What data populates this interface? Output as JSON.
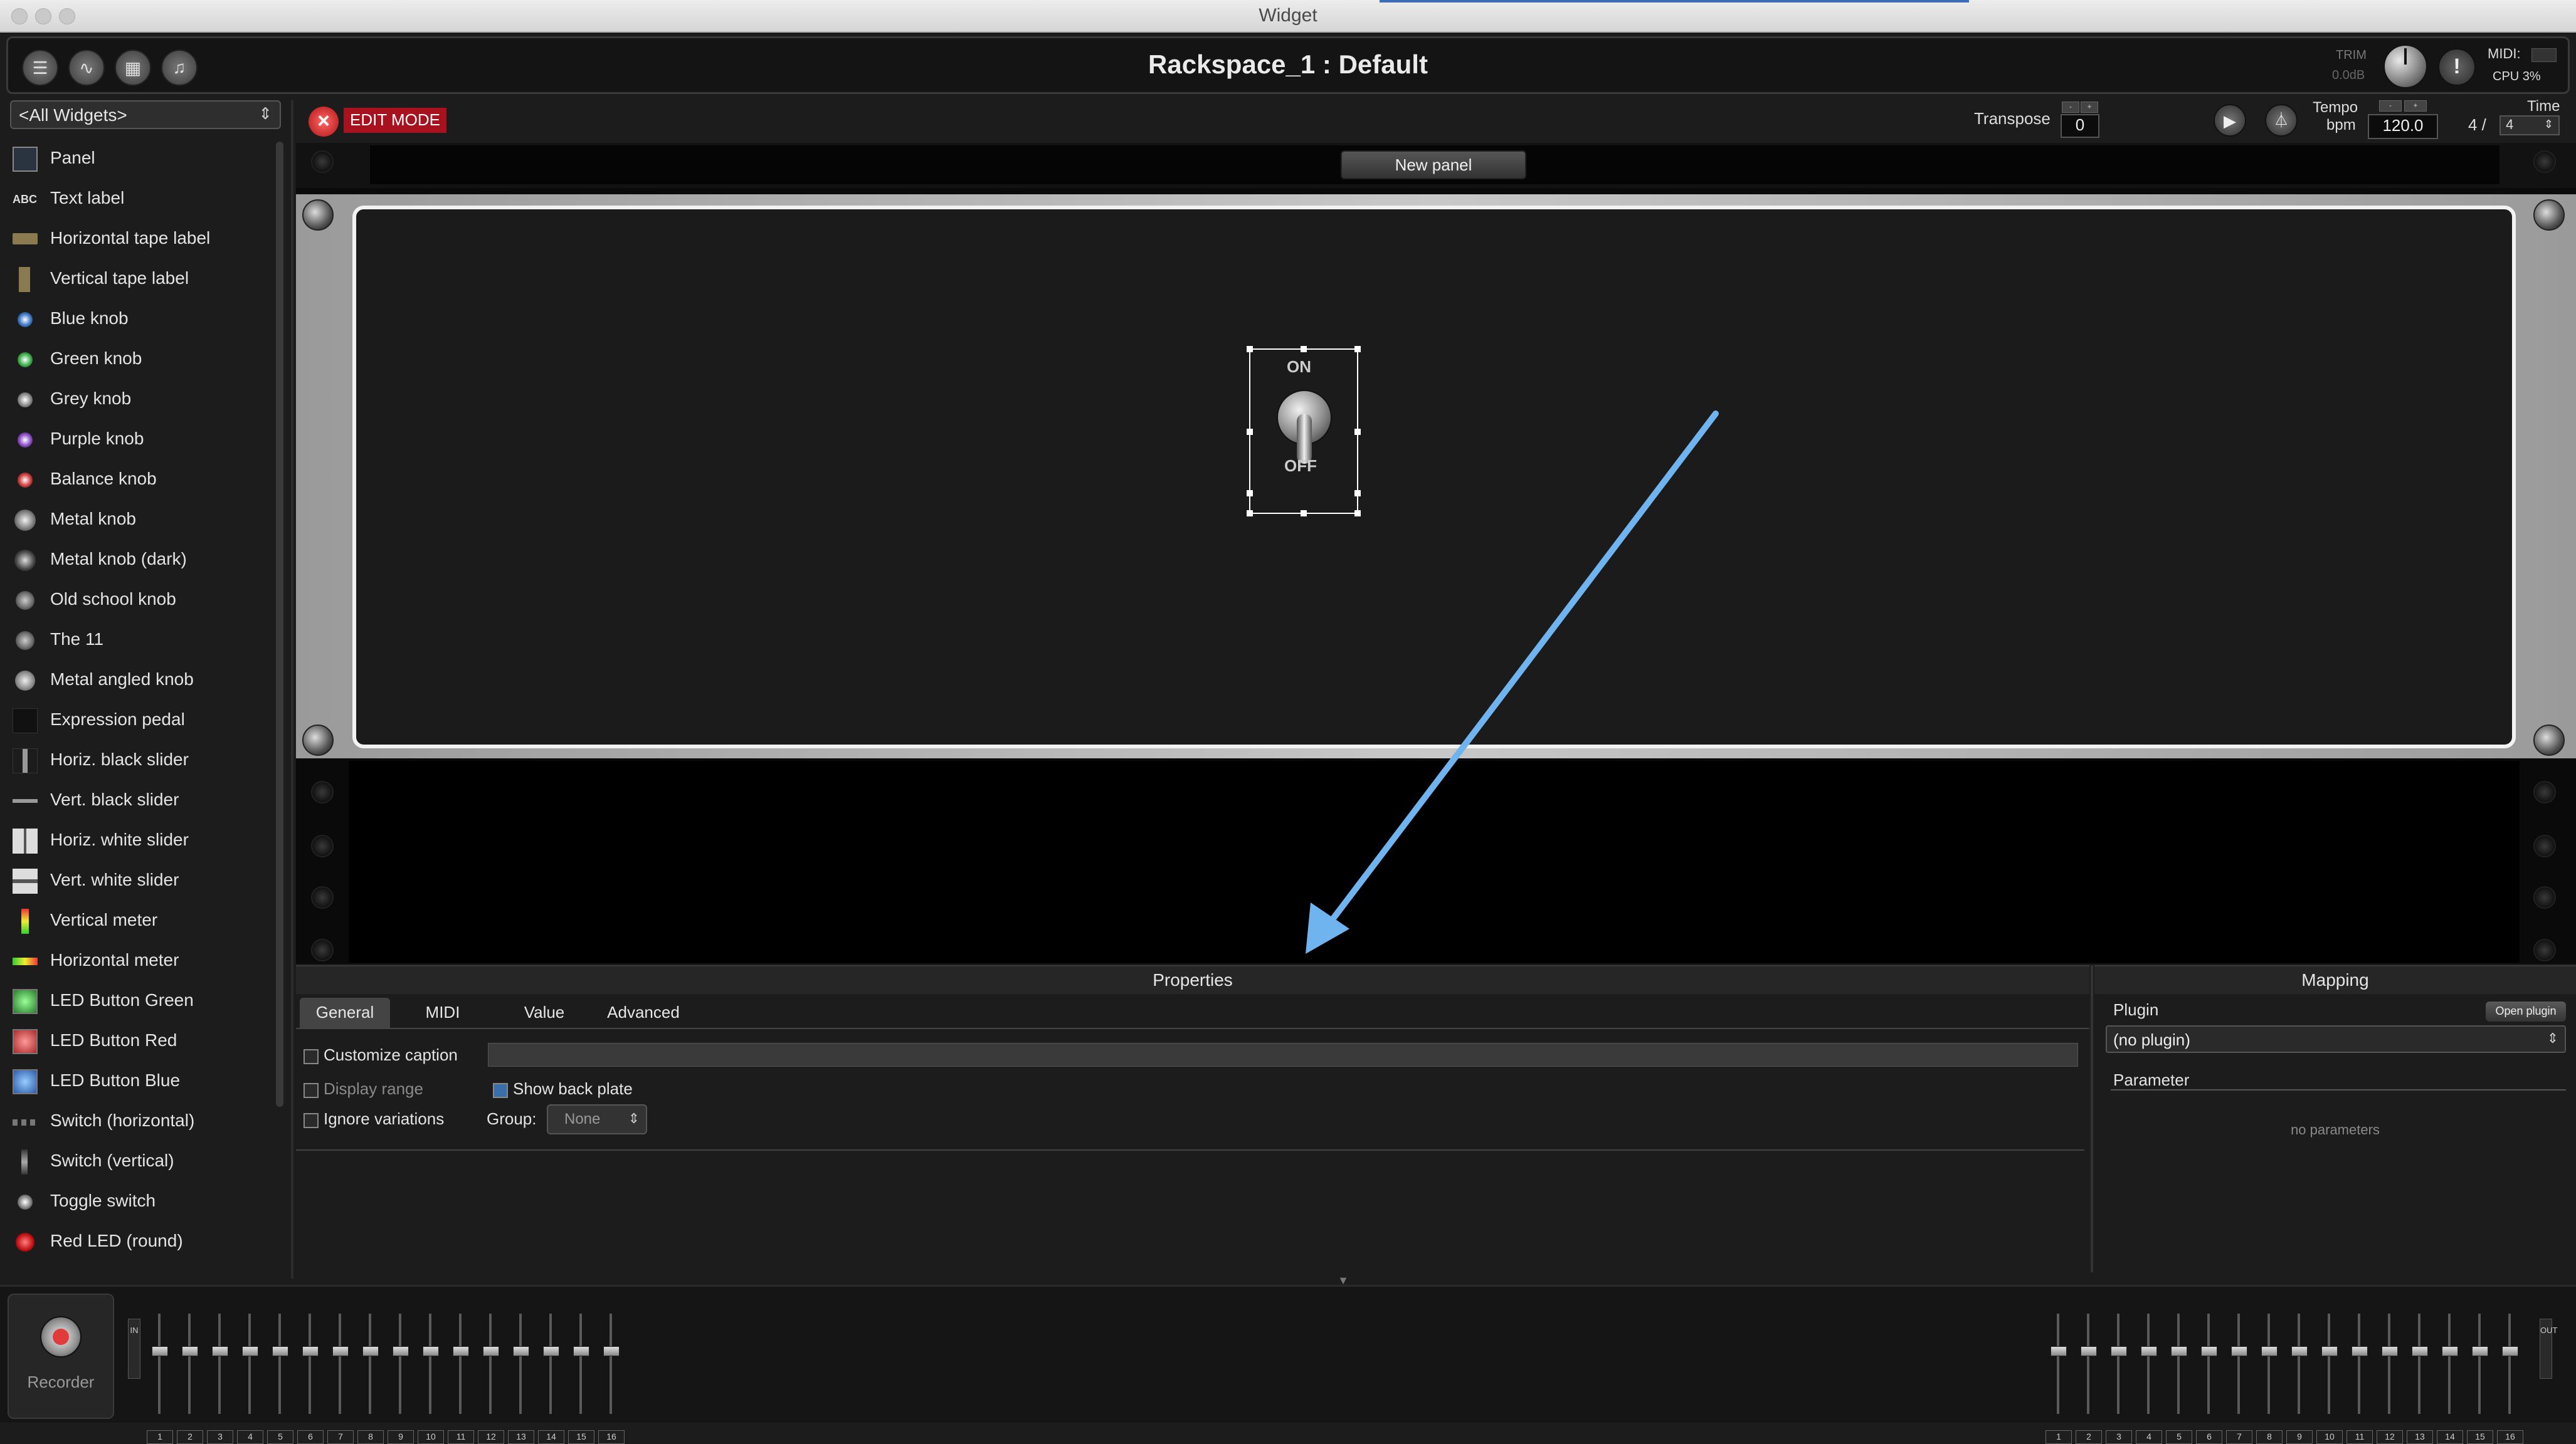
{
  "window": {
    "title": "Widget"
  },
  "header": {
    "rackspace_title": "Rackspace_1 : Default",
    "trim_label": "TRIM",
    "trim_value": "0.0dB",
    "panic_symbol": "!",
    "midi_label": "MIDI:",
    "cpu_label": "CPU 3%"
  },
  "sidebar": {
    "filter": "<All Widgets>",
    "items": [
      {
        "label": "Panel",
        "icon": "panel-icon"
      },
      {
        "label": "Text label",
        "icon": "abc-text-icon"
      },
      {
        "label": "Horizontal tape label",
        "icon": "tape-label-icon"
      },
      {
        "label": "Vertical tape label",
        "icon": "vertical-tape-icon"
      },
      {
        "label": "Blue knob",
        "icon": "blue-knob-icon"
      },
      {
        "label": "Green knob",
        "icon": "green-knob-icon"
      },
      {
        "label": "Grey knob",
        "icon": "grey-knob-icon"
      },
      {
        "label": "Purple knob",
        "icon": "purple-knob-icon"
      },
      {
        "label": "Balance knob",
        "icon": "balance-knob-icon"
      },
      {
        "label": "Metal knob",
        "icon": "metal-knob-icon"
      },
      {
        "label": "Metal knob (dark)",
        "icon": "metal-knob-dark-icon"
      },
      {
        "label": "Old school knob",
        "icon": "old-school-knob-icon"
      },
      {
        "label": "The 11",
        "icon": "the-11-knob-icon"
      },
      {
        "label": "Metal angled knob",
        "icon": "metal-angled-knob-icon"
      },
      {
        "label": "Expression pedal",
        "icon": "expression-pedal-icon"
      },
      {
        "label": "Horiz. black slider",
        "icon": "horiz-black-slider-icon"
      },
      {
        "label": "Vert. black slider",
        "icon": "vert-black-slider-icon"
      },
      {
        "label": "Horiz. white slider",
        "icon": "horiz-white-slider-icon"
      },
      {
        "label": "Vert. white slider",
        "icon": "vert-white-slider-icon"
      },
      {
        "label": "Vertical meter",
        "icon": "vertical-meter-icon"
      },
      {
        "label": "Horizontal meter",
        "icon": "horizontal-meter-icon"
      },
      {
        "label": "LED Button Green",
        "icon": "led-button-green-icon"
      },
      {
        "label": "LED Button Red",
        "icon": "led-button-red-icon"
      },
      {
        "label": "LED Button Blue",
        "icon": "led-button-blue-icon"
      },
      {
        "label": "Switch (horizontal)",
        "icon": "switch-horizontal-icon"
      },
      {
        "label": "Switch (vertical)",
        "icon": "switch-vertical-icon"
      },
      {
        "label": "Toggle switch",
        "icon": "toggle-switch-icon"
      },
      {
        "label": "Red LED (round)",
        "icon": "red-led-icon"
      }
    ]
  },
  "toolbar": {
    "edit_mode": "EDIT MODE",
    "transpose_label": "Transpose",
    "transpose_value": "0",
    "tempo_label": "Tempo",
    "bpm_label": "bpm",
    "tempo_value": "120.0",
    "time_label": "Time",
    "time_numerator": "4 /",
    "time_denominator": "4"
  },
  "rack": {
    "new_panel_button": "New panel",
    "toggle_on_label": "ON",
    "toggle_off_label": "OFF"
  },
  "properties": {
    "title": "Properties",
    "tabs": [
      "General",
      "MIDI",
      "Value",
      "Advanced"
    ],
    "active_tab": "General",
    "customize_caption": "Customize caption",
    "display_range": "Display range",
    "show_back_plate": "Show back plate",
    "ignore_variations": "Ignore variations",
    "group_label": "Group:",
    "group_value": "None"
  },
  "mapping": {
    "title": "Mapping",
    "plugin_label": "Plugin",
    "open_plugin_button": "Open plugin",
    "plugin_value": "(no plugin)",
    "parameter_label": "Parameter",
    "no_parameters": "no parameters"
  },
  "bottom": {
    "recorder_label": "Recorder",
    "in_label": "IN",
    "out_label": "OUT",
    "channels": [
      "1",
      "2",
      "3",
      "4",
      "5",
      "6",
      "7",
      "8",
      "9",
      "10",
      "11",
      "12",
      "13",
      "14",
      "15",
      "16"
    ]
  },
  "colors": {
    "edit_mode_red": "#a8121f",
    "arrow_blue": "#6fb4ef",
    "checkbox_on": "#3a6ea8"
  }
}
